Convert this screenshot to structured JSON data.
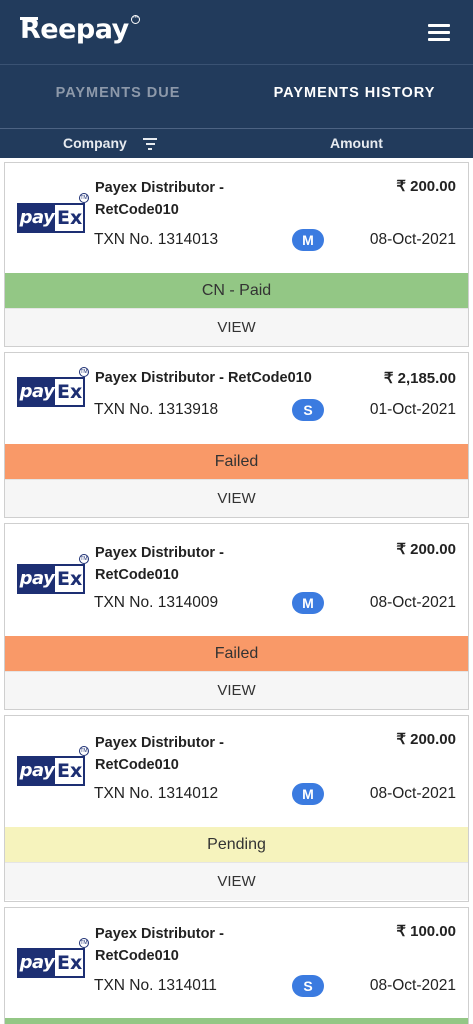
{
  "app": {
    "logo_text": "Reepay"
  },
  "tabs": [
    {
      "label": "PAYMENTS DUE",
      "active": false
    },
    {
      "label": "PAYMENTS HISTORY",
      "active": true
    }
  ],
  "columns": {
    "company": "Company",
    "amount": "Amount"
  },
  "brand": {
    "logo_left": "pay",
    "logo_right": "Ex",
    "logo_tm": "TM"
  },
  "colors": {
    "header": "#223b5c",
    "badge": "#3b7be0",
    "paid": "#93c785",
    "failed": "#f99968",
    "pending": "#f6f3bd"
  },
  "payments": [
    {
      "company_line1": "Payex Distributor -",
      "company_line2": "RetCode010",
      "amount": "₹ 200.00",
      "txn": "TXN No. 1314013",
      "mode": "M",
      "date": "08-Oct-2021",
      "status": "CN - Paid",
      "view": "VIEW"
    },
    {
      "company_line1": "Payex Distributor - RetCode010",
      "company_line2": "",
      "amount": "₹ 2,185.00",
      "txn": "TXN No. 1313918",
      "mode": "S",
      "date": "01-Oct-2021",
      "status": "Failed",
      "view": "VIEW"
    },
    {
      "company_line1": "Payex Distributor -",
      "company_line2": "RetCode010",
      "amount": "₹ 200.00",
      "txn": "TXN No. 1314009",
      "mode": "M",
      "date": "08-Oct-2021",
      "status": "Failed",
      "view": "VIEW"
    },
    {
      "company_line1": "Payex Distributor -",
      "company_line2": "RetCode010",
      "amount": "₹ 200.00",
      "txn": "TXN No. 1314012",
      "mode": "M",
      "date": "08-Oct-2021",
      "status": "Pending",
      "view": "VIEW"
    },
    {
      "company_line1": "Payex Distributor -",
      "company_line2": "RetCode010",
      "amount": "₹ 100.00",
      "txn": "TXN No. 1314011",
      "mode": "S",
      "date": "08-Oct-2021",
      "status": "",
      "view": ""
    }
  ]
}
